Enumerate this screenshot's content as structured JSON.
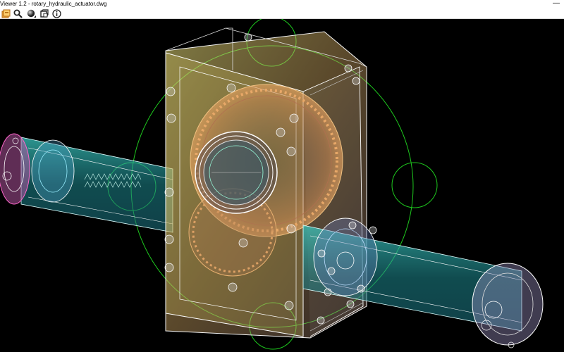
{
  "window": {
    "title": "Viewer 1.2 - rotary_hydraulic_actuator.dwg",
    "minimize_glyph": "—"
  },
  "toolbar": {
    "buttons": [
      {
        "name": "open-file-icon"
      },
      {
        "name": "zoom-icon"
      },
      {
        "name": "shading-mode-icon"
      },
      {
        "name": "view-cube-icon"
      },
      {
        "name": "info-icon"
      }
    ]
  },
  "viewport": {
    "background": "#000000",
    "model": "rotary hydraulic actuator wireframe",
    "colors": {
      "housing": "#e0cf70",
      "gear": "#d9935a",
      "cylinder": "#2fb8b0",
      "end_cap": "#c060a8",
      "guide_circle": "#1ec81e",
      "edge": "#f4f4f4"
    }
  }
}
